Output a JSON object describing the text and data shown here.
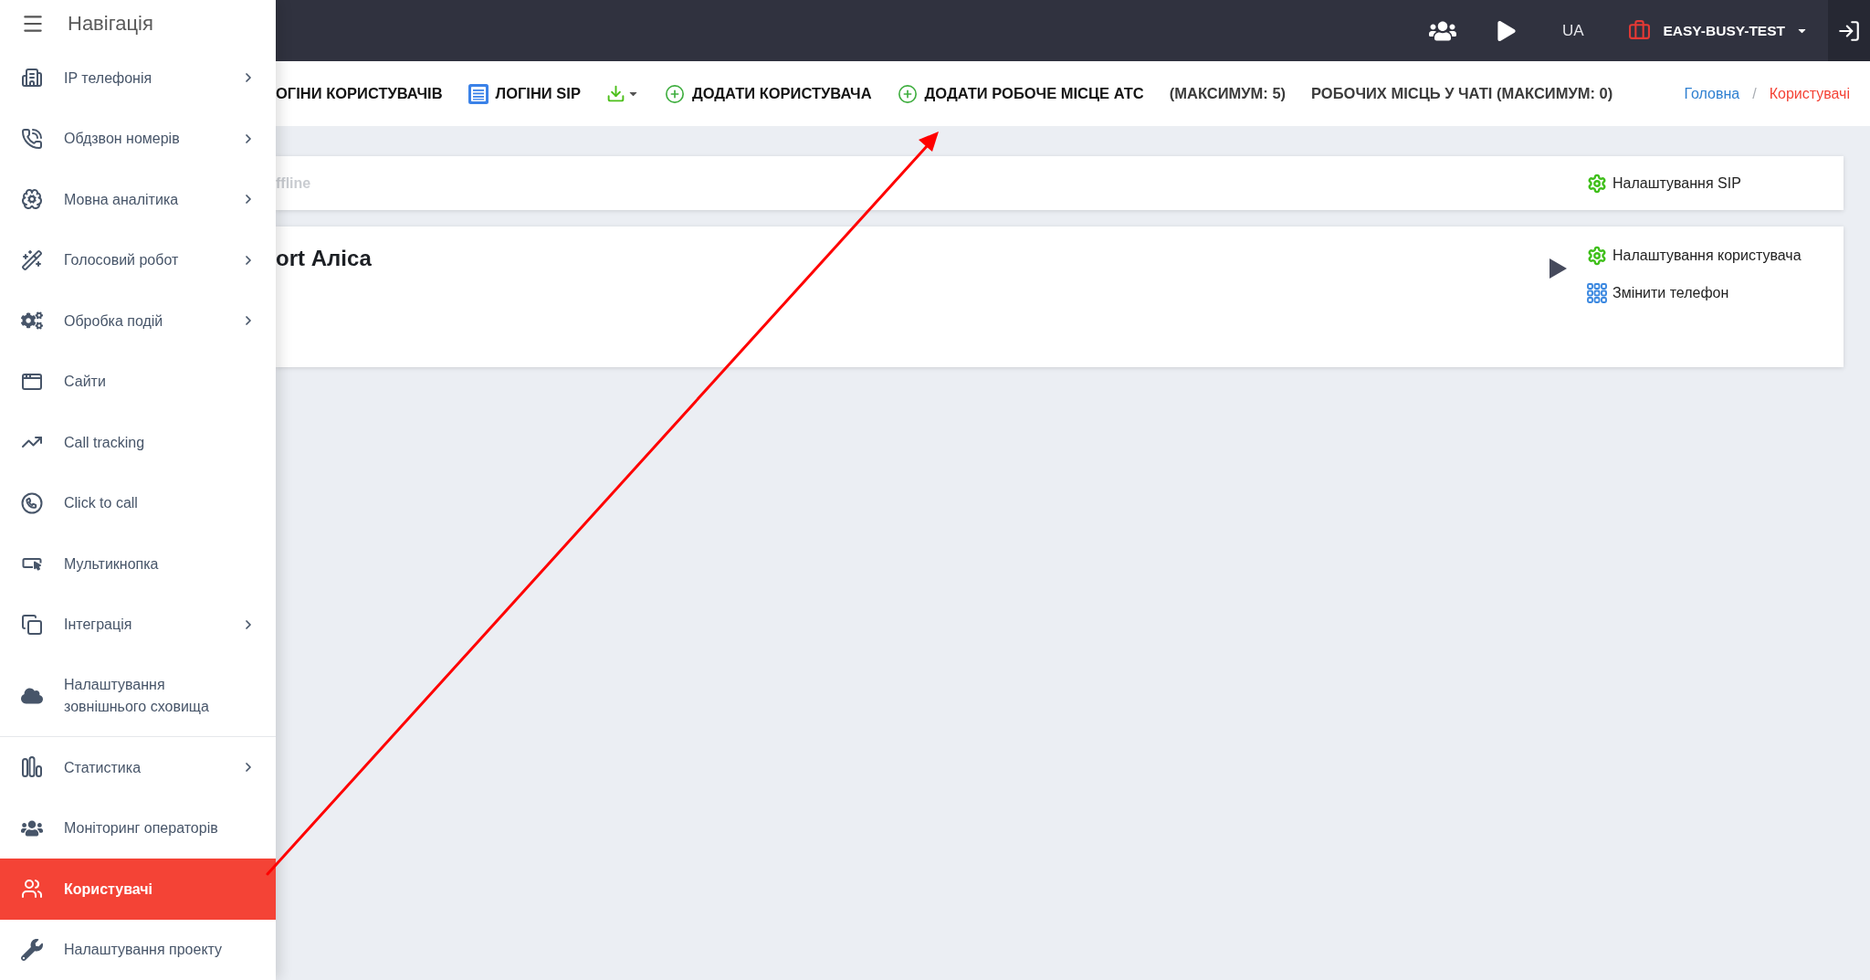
{
  "sidebar": {
    "title": "Навігація",
    "items": [
      {
        "label": "IP телефонія",
        "submenu": true,
        "selected": false,
        "divider": false
      },
      {
        "label": "Обдзвон номерів",
        "submenu": true,
        "selected": false,
        "divider": false
      },
      {
        "label": "Мовна аналітика",
        "submenu": true,
        "selected": false,
        "divider": false
      },
      {
        "label": "Голосовий робот",
        "submenu": true,
        "selected": false,
        "divider": false
      },
      {
        "label": "Обробка подій",
        "submenu": true,
        "selected": false,
        "divider": false
      },
      {
        "label": "Сайти",
        "submenu": false,
        "selected": false,
        "divider": false
      },
      {
        "label": "Call tracking",
        "submenu": false,
        "selected": false,
        "divider": false
      },
      {
        "label": "Click to call",
        "submenu": false,
        "selected": false,
        "divider": false
      },
      {
        "label": "Мультикнопка",
        "submenu": false,
        "selected": false,
        "divider": false
      },
      {
        "label": "Інтеграція",
        "submenu": true,
        "selected": false,
        "divider": false
      },
      {
        "label": "Налаштування\nзовнішнього сховища",
        "submenu": false,
        "selected": false,
        "divider": true
      },
      {
        "label": "Статистика",
        "submenu": true,
        "selected": false,
        "divider": false
      },
      {
        "label": "Моніторинг операторів",
        "submenu": false,
        "selected": false,
        "divider": false
      },
      {
        "label": "Користувачі",
        "submenu": false,
        "selected": true,
        "divider": false
      },
      {
        "label": "Налаштування проекту",
        "submenu": false,
        "selected": false,
        "divider": false
      }
    ]
  },
  "topbar": {
    "language": "UA",
    "project": "EASY-BUSY-TEST"
  },
  "toolbar": {
    "items": [
      {
        "kind": "link",
        "label": "ОГІНИ КОРИСТУВАЧІВ"
      },
      {
        "kind": "list",
        "label": "ЛОГІНИ SIP"
      },
      {
        "kind": "download"
      },
      {
        "kind": "add",
        "label": "ДОДАТИ КОРИСТУВАЧА"
      },
      {
        "kind": "add",
        "label": "ДОДАТИ РОБОЧЕ МІСЦЕ АТС"
      },
      {
        "kind": "note",
        "label": "(МАКСИМУМ: 5)"
      },
      {
        "kind": "note",
        "label": "РОБОЧИХ МІСЦЬ У ЧАТІ (МАКСИМУМ: 0)"
      }
    ]
  },
  "breadcrumb": {
    "separator": "/",
    "items": [
      {
        "label": "Головна",
        "selected": false
      },
      {
        "label": "Користувачі",
        "selected": true
      }
    ]
  },
  "cards": [
    {
      "kind": "status",
      "text": "ffline",
      "actions": [
        {
          "kind": "settings",
          "label": "Налаштування SIP"
        }
      ]
    },
    {
      "kind": "user",
      "text": "ort Аліса",
      "actions": [
        {
          "kind": "settings",
          "label": "Налаштування користувача"
        },
        {
          "kind": "phone",
          "label": "Змінити телефон"
        }
      ]
    }
  ]
}
